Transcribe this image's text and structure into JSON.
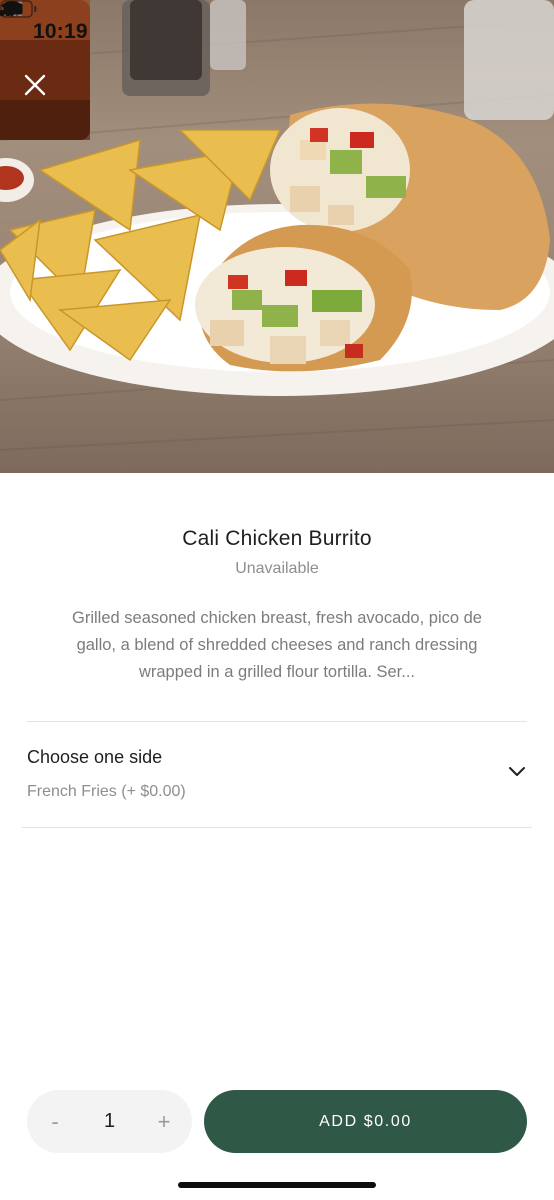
{
  "status_bar": {
    "time": "10:19"
  },
  "item": {
    "title": "Cali Chicken Burrito",
    "status": "Unavailable",
    "description": "Grilled seasoned chicken breast, fresh avocado, pico de gallo, a blend of shredded cheeses and ranch dressing wrapped in a grilled flour tortilla. Ser..."
  },
  "option": {
    "title": "Choose one side",
    "selected": "French Fries (+ $0.00)"
  },
  "quantity": {
    "minus_label": "-",
    "value": "1",
    "plus_label": "+"
  },
  "add_button": {
    "label": "ADD $0.00"
  },
  "icons": {
    "close": "close-icon",
    "chevron": "chevron-down-icon",
    "location": "location-arrow-icon",
    "signal": "signal-icon",
    "wifi": "wifi-icon",
    "battery": "battery-icon"
  },
  "colors": {
    "accent": "#2f5847",
    "muted_text": "#8e8e8e",
    "stepper_bg": "#f3f3f3"
  }
}
